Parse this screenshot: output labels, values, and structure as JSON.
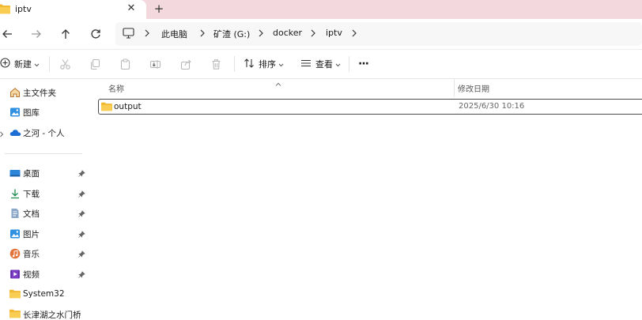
{
  "tab": {
    "title": "iptv",
    "close_glyph": "✕",
    "new_tab_glyph": "+"
  },
  "address": {
    "segments": [
      "此电脑",
      "矿渣 (G:)",
      "docker",
      "iptv"
    ]
  },
  "toolbar": {
    "new_label": "新建",
    "sort_label": "排序",
    "view_label": "查看",
    "more_glyph": "···"
  },
  "sidebar": {
    "items": [
      {
        "label": "主文件夹",
        "icon": "home-icon"
      },
      {
        "label": "图库",
        "icon": "gallery-icon"
      },
      {
        "label": "之河 - 个人",
        "icon": "onedrive-cloud-icon"
      },
      {
        "label": "桌面",
        "icon": "desktop-icon",
        "pinned": true
      },
      {
        "label": "下载",
        "icon": "download-icon",
        "pinned": true
      },
      {
        "label": "文档",
        "icon": "document-icon",
        "pinned": true
      },
      {
        "label": "图片",
        "icon": "pictures-icon",
        "pinned": true
      },
      {
        "label": "音乐",
        "icon": "music-icon",
        "pinned": true
      },
      {
        "label": "视频",
        "icon": "video-icon",
        "pinned": true
      },
      {
        "label": "System32",
        "icon": "folder-icon"
      },
      {
        "label": "长津湖之水门桥",
        "icon": "folder-icon"
      }
    ]
  },
  "columns": {
    "name": "名称",
    "date_modified": "修改日期"
  },
  "files": [
    {
      "name": "output",
      "date_modified": "2025/6/30 10:16",
      "type": "folder"
    }
  ],
  "colors": {
    "titlebar": "#f3d9de",
    "folder": "#f5c342",
    "accent": "#0067c0"
  }
}
